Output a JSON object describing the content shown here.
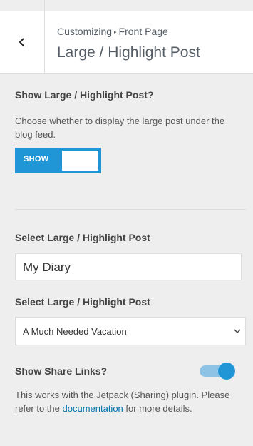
{
  "header": {
    "breadcrumb_root": "Customizing",
    "breadcrumb_sep": "▸",
    "breadcrumb_section": "Front Page",
    "title": "Large / Highlight Post",
    "back_icon": "chevron-left-icon"
  },
  "show_highlight": {
    "label": "Show Large / Highlight Post?",
    "description": "Choose whether to display the large post under the blog feed.",
    "toggle_label": "SHOW",
    "state": "on"
  },
  "select_post_input": {
    "label": "Select Large / Highlight Post",
    "value": "My Diary"
  },
  "select_post_dropdown": {
    "label": "Select Large / Highlight Post",
    "value": "A Much Needed Vacation",
    "icon": "chevron-down-icon"
  },
  "share_links": {
    "label": "Show Share Links?",
    "state": "on",
    "description_before": "This works with the Jetpack (Sharing) plugin. Please refer to the",
    "link_text": "documentation",
    "description_after": "for more details."
  },
  "colors": {
    "accent": "#2196d7",
    "link": "#0073aa",
    "panel_bg": "#eeeeee"
  }
}
